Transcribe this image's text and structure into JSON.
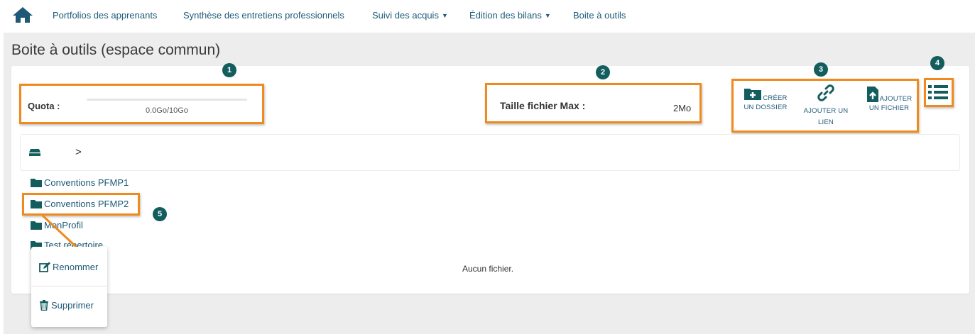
{
  "navbar": {
    "items": [
      {
        "label": "Portfolios des apprenants",
        "dropdown": false
      },
      {
        "label": "Synthèse des entretiens professionnels",
        "dropdown": false
      },
      {
        "label": "Suivi des acquis",
        "dropdown": true
      },
      {
        "label": "Édition des bilans",
        "dropdown": true
      },
      {
        "label": "Boite à outils",
        "dropdown": false
      }
    ]
  },
  "page": {
    "title": "Boite à outils (espace commun)"
  },
  "quota": {
    "label": "Quota :",
    "used_fraction": 0.0,
    "text": "0.0Go/10Go"
  },
  "max_file": {
    "label": "Taille fichier Max :",
    "value": "2Mo"
  },
  "actions": {
    "create_folder": [
      "CRÉER",
      "UN DOSSIER"
    ],
    "add_link": [
      "AJOUTER UN",
      "LIEN"
    ],
    "add_file": [
      "AJOUTER",
      "UN FICHIER"
    ]
  },
  "breadcrumb": {
    "separator": ">"
  },
  "folders": [
    "Conventions PFMP1",
    "Conventions PFMP2",
    "MonProfil",
    "Test répertoire"
  ],
  "empty_message": "Aucun fichier.",
  "context_menu": {
    "rename": "Renommer",
    "delete": "Supprimer"
  },
  "badges": [
    "1",
    "2",
    "3",
    "4",
    "5"
  ],
  "colors": {
    "accent": "#1e5a78",
    "highlight": "#f08a1c",
    "badge": "#135d5e",
    "page_bg": "#ededed"
  },
  "icons": [
    "home-icon",
    "folder-plus-icon",
    "link-icon",
    "file-upload-icon",
    "list-icon",
    "drive-icon",
    "folder-icon",
    "edit-icon",
    "trash-icon"
  ]
}
